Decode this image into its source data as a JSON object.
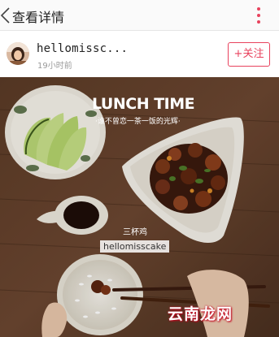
{
  "header": {
    "title": "查看详情",
    "accent_color": "#e8425d",
    "back_icon": "chevron-left-icon",
    "more_icon": "more-vertical-icon"
  },
  "author": {
    "name": "hellomissc...",
    "time": "19小时前",
    "follow_label": "+关注"
  },
  "photo": {
    "title": "LUNCH TIME",
    "subtitle": "·谁不曾恋一茶一饭的光辉·",
    "dish_name": "三杯鸡",
    "handle": "hellomisscake",
    "watermark": "云南龙网"
  }
}
